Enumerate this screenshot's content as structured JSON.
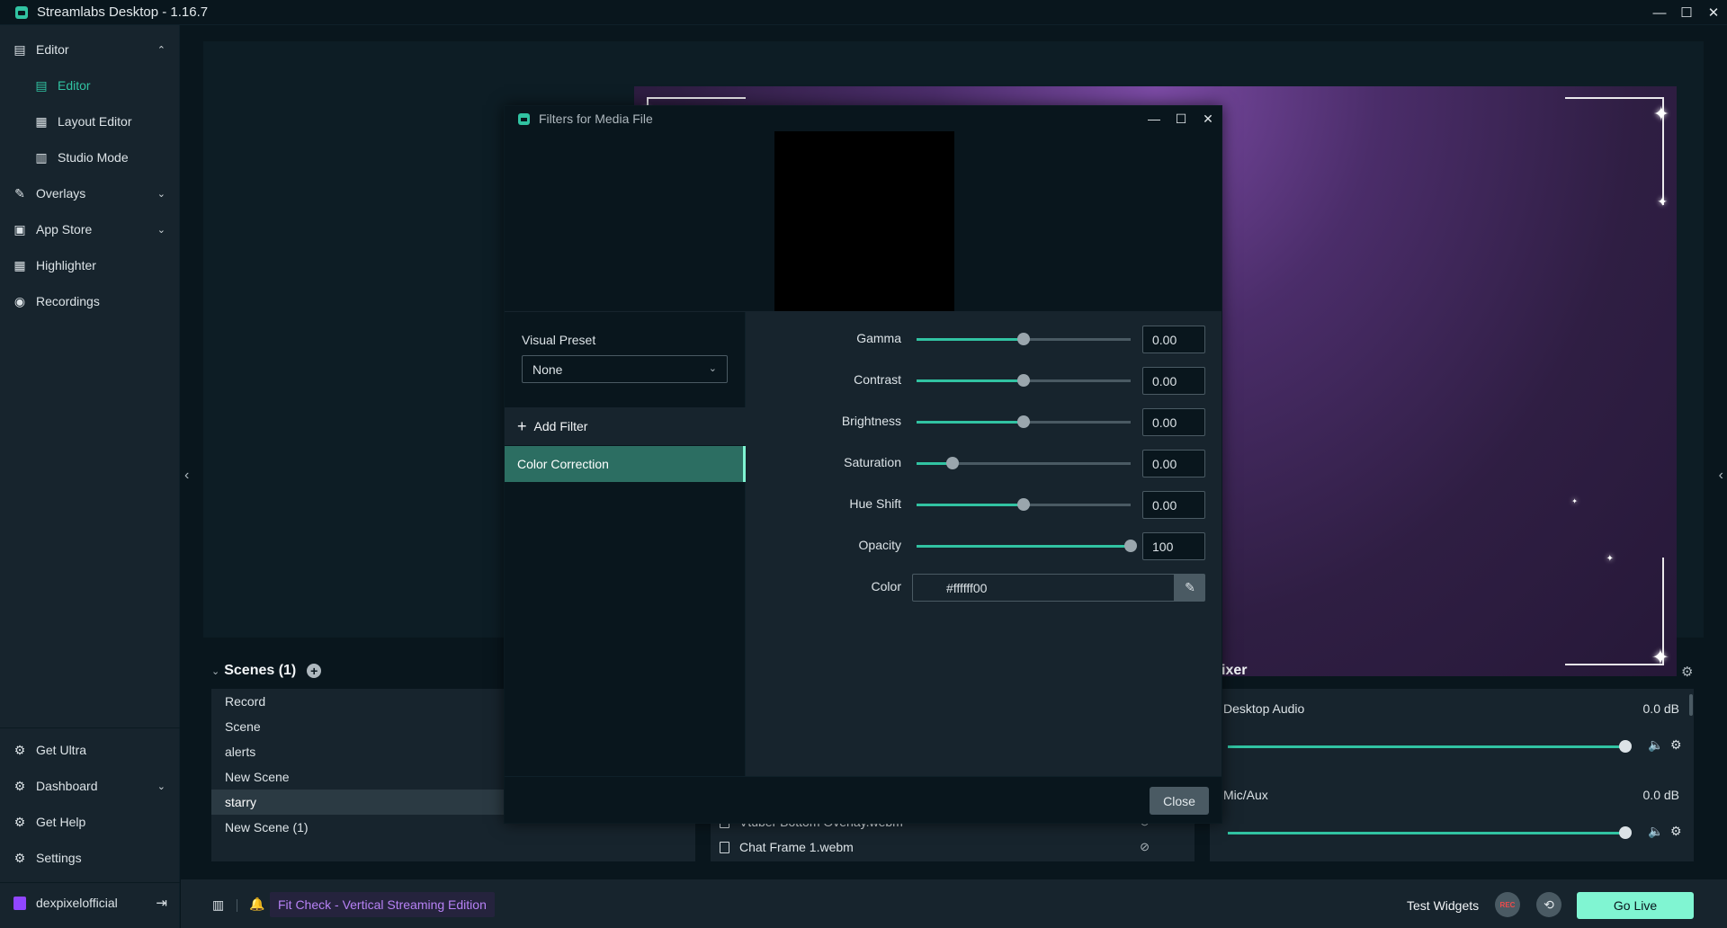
{
  "app": {
    "title": "Streamlabs Desktop - 1.16.7",
    "controls": {
      "minimize": "—",
      "maximize": "☐",
      "close": "✕"
    }
  },
  "sidebar": {
    "items": [
      {
        "label": "Editor",
        "icon": "editor-icon",
        "glyph": "▤",
        "chevron": "⌃"
      },
      {
        "label": "Editor",
        "icon": "editor-icon",
        "glyph": "▤"
      },
      {
        "label": "Layout Editor",
        "icon": "layout-icon",
        "glyph": "▦"
      },
      {
        "label": "Studio Mode",
        "icon": "studio-mode-icon",
        "glyph": "▥"
      },
      {
        "label": "Overlays",
        "icon": "overlays-icon",
        "glyph": "✎",
        "chevron": "⌄"
      },
      {
        "label": "App Store",
        "icon": "store-icon",
        "glyph": "▣",
        "chevron": "⌄"
      },
      {
        "label": "Highlighter",
        "icon": "highlighter-icon",
        "glyph": "▦"
      },
      {
        "label": "Recordings",
        "icon": "recordings-icon",
        "glyph": "◉"
      }
    ],
    "bottom_items": [
      {
        "label": "Get Ultra",
        "icon": "ultra-icon",
        "glyph": "⚙"
      },
      {
        "label": "Dashboard",
        "icon": "dashboard-icon",
        "glyph": "⚙",
        "chevron": "⌄"
      },
      {
        "label": "Get Help",
        "icon": "help-icon",
        "glyph": "⚙"
      },
      {
        "label": "Settings",
        "icon": "settings-icon",
        "glyph": "⚙"
      }
    ],
    "user": {
      "name": "dexpixelofficial",
      "logout_glyph": "⇥"
    }
  },
  "scenes": {
    "title": "Scenes (1)",
    "items": [
      "Record",
      "Scene",
      "alerts",
      "New Scene",
      "starry",
      "New Scene (1)"
    ],
    "selected": "starry"
  },
  "sources": {
    "items": [
      "Vtuber Bottom Overlay.webm",
      "Chat Frame 1.webm"
    ]
  },
  "mixer": {
    "title": "ixer",
    "items": [
      {
        "name": "Desktop Audio",
        "db": "0.0 dB",
        "level": 1.0
      },
      {
        "name": "Mic/Aux",
        "db": "0.0 dB",
        "level": 1.0
      }
    ]
  },
  "footer": {
    "notification": "Fit Check - Vertical Streaming Edition",
    "test_widgets": "Test Widgets",
    "rec_label": "REC",
    "go_live": "Go Live"
  },
  "modal": {
    "title": "Filters for Media File",
    "visual_preset_label": "Visual Preset",
    "visual_preset_value": "None",
    "add_filter_label": "Add Filter",
    "filters": [
      "Color Correction"
    ],
    "selected_filter": "Color Correction",
    "properties": [
      {
        "label": "Gamma",
        "value": "0.00",
        "level": 0.5
      },
      {
        "label": "Contrast",
        "value": "0.00",
        "level": 0.5
      },
      {
        "label": "Brightness",
        "value": "0.00",
        "level": 0.5
      },
      {
        "label": "Saturation",
        "value": "0.00",
        "level": 0.17
      },
      {
        "label": "Hue Shift",
        "value": "0.00",
        "level": 0.5
      },
      {
        "label": "Opacity",
        "value": "100",
        "level": 1.0
      }
    ],
    "color_label": "Color",
    "color_value": "#ffffff00",
    "close_label": "Close"
  },
  "colors": {
    "accent": "#31c3a2",
    "go_live_bg": "#80f5d2",
    "notification_text": "#b782f5",
    "selected_filter_bg": "#2c6e62"
  }
}
